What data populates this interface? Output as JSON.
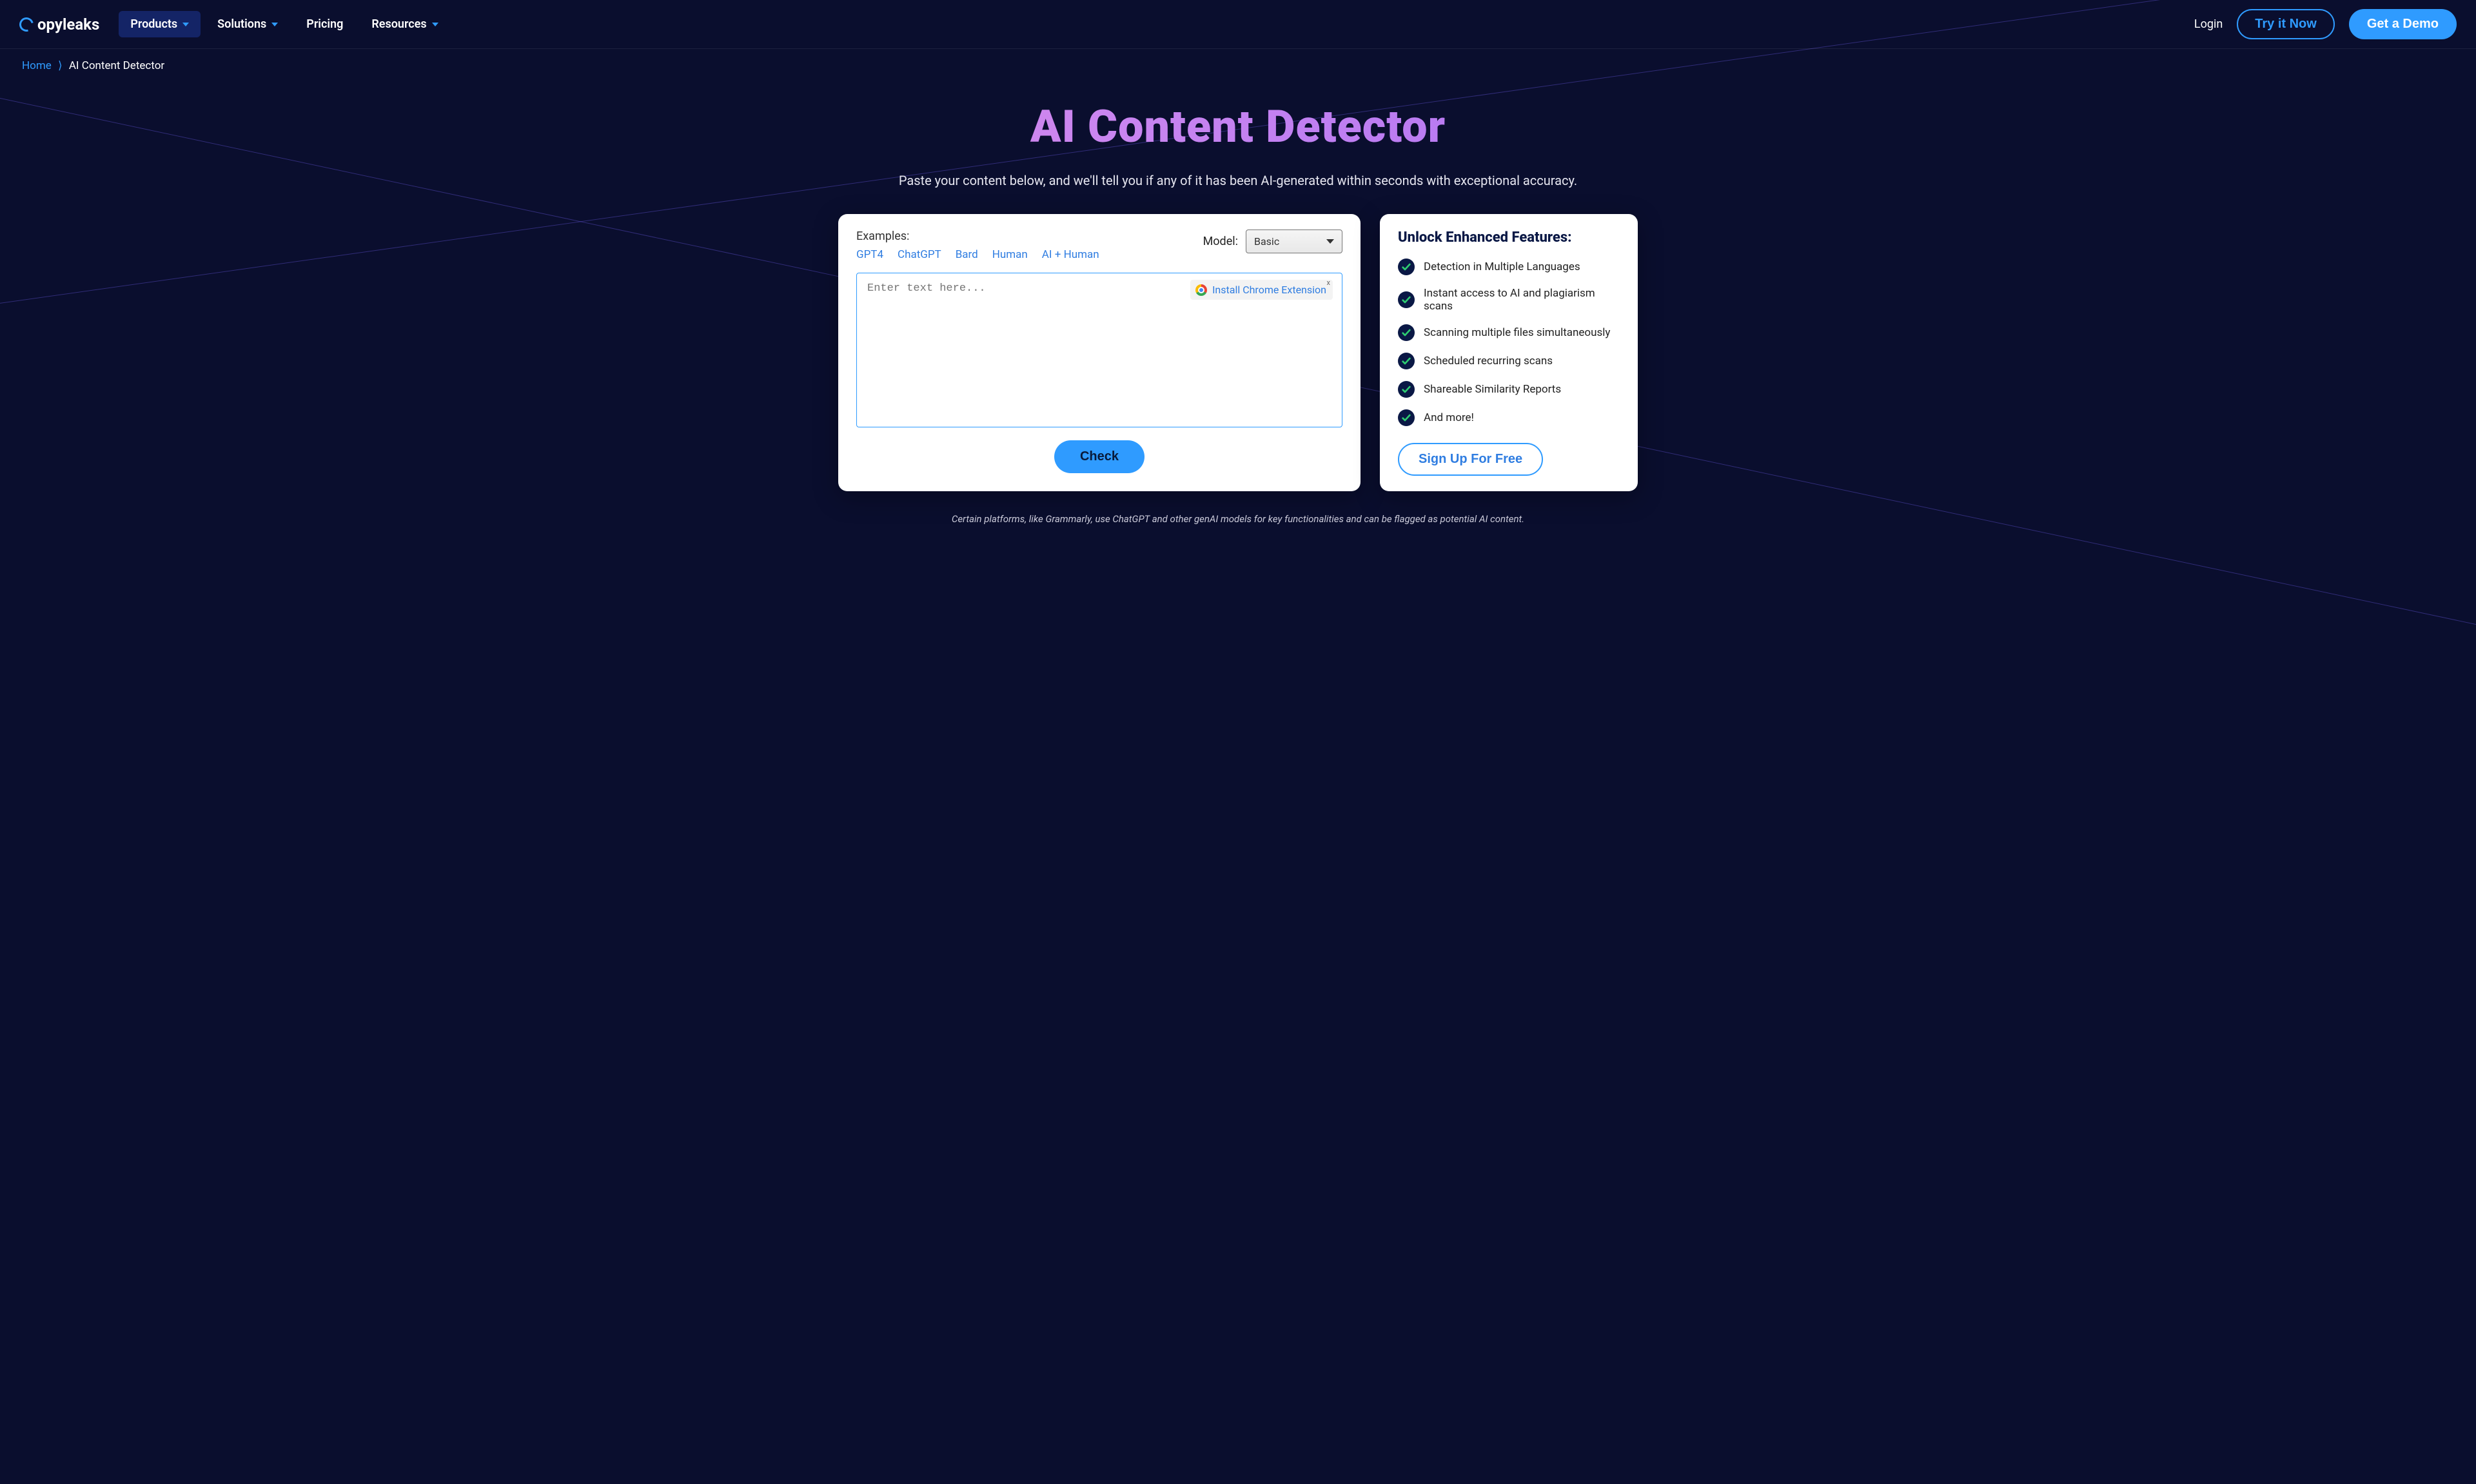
{
  "header": {
    "logo_text": "opyleaks",
    "nav": [
      {
        "label": "Products",
        "has_caret": true,
        "active": true
      },
      {
        "label": "Solutions",
        "has_caret": true,
        "active": false
      },
      {
        "label": "Pricing",
        "has_caret": false,
        "active": false
      },
      {
        "label": "Resources",
        "has_caret": true,
        "active": false
      }
    ],
    "login": "Login",
    "try_it": "Try it Now",
    "demo": "Get a Demo"
  },
  "breadcrumb": {
    "home": "Home",
    "sep": "⟩",
    "current": "AI Content Detector"
  },
  "hero": {
    "title": "AI Content Detector",
    "subtitle": "Paste your content below, and we'll tell you if any of it has been AI-generated within seconds with exceptional accuracy."
  },
  "main": {
    "examples_label": "Examples:",
    "examples": [
      "GPT4",
      "ChatGPT",
      "Bard",
      "Human",
      "AI + Human"
    ],
    "model_label": "Model:",
    "model_value": "Basic",
    "placeholder": "Enter text here...",
    "extension_label": "Install Chrome Extension",
    "extension_close": "x",
    "check": "Check"
  },
  "side": {
    "title": "Unlock Enhanced Features:",
    "features": [
      "Detection in Multiple Languages",
      "Instant access to AI and plagiarism scans",
      "Scanning multiple files simultaneously",
      "Scheduled recurring scans",
      "Shareable Similarity Reports",
      "And more!"
    ],
    "signup": "Sign Up For Free"
  },
  "footnote": "Certain platforms, like Grammarly, use ChatGPT and other genAI models for key functionalities and can be flagged as potential AI content."
}
